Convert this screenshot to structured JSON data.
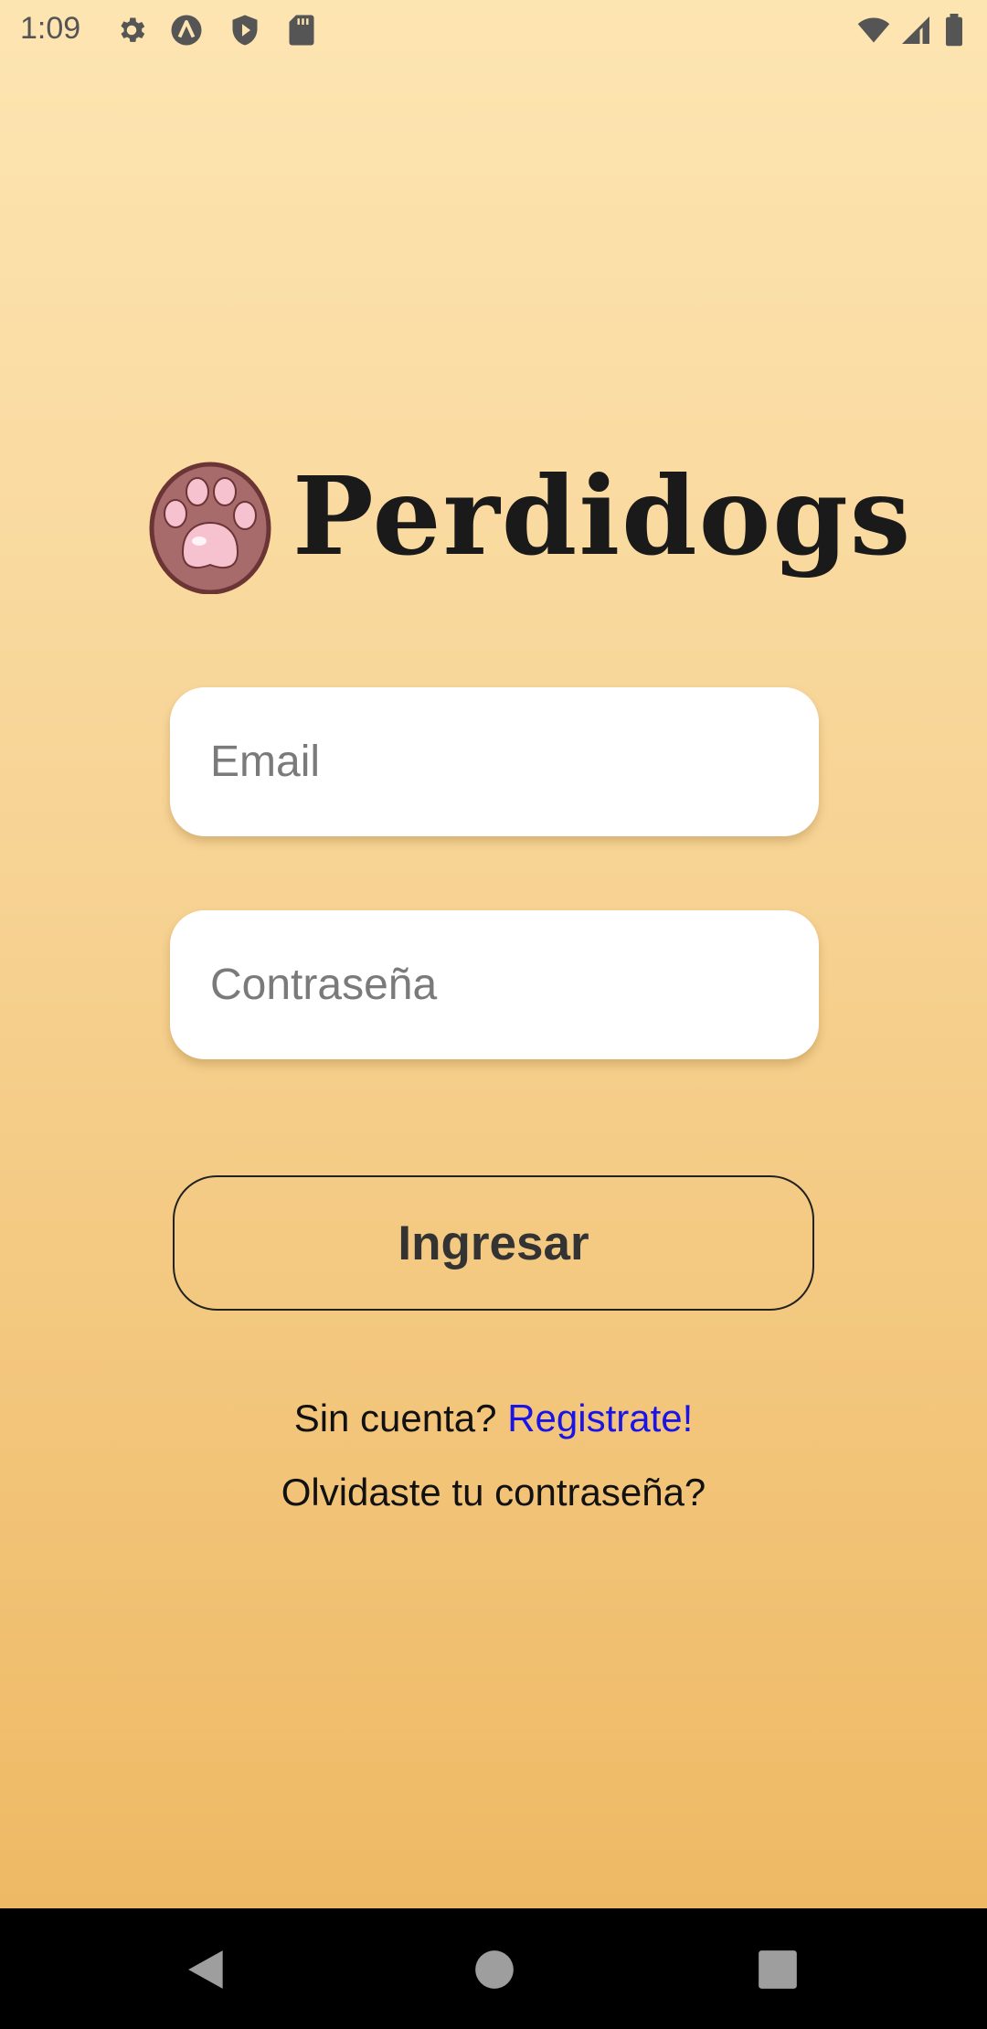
{
  "status_bar": {
    "time": "1:09",
    "left_icons": [
      "settings-icon",
      "app-a-icon",
      "shield-play-icon",
      "sd-card-icon"
    ],
    "right_icons": [
      "wifi-icon",
      "signal-icon",
      "battery-icon"
    ]
  },
  "brand": {
    "logo_icon": "paw-icon",
    "name": "Perdidogs"
  },
  "form": {
    "email": {
      "placeholder": "Email",
      "value": ""
    },
    "password": {
      "placeholder": "Contraseña",
      "value": ""
    },
    "submit_label": "Ingresar"
  },
  "links": {
    "signup_prompt": "Sin cuenta?",
    "signup_link": "Registrate!",
    "forgot_password": "Olvidaste tu contraseña?"
  },
  "nav_bar": {
    "buttons": [
      "back-icon",
      "home-icon",
      "recents-icon"
    ]
  },
  "colors": {
    "background_top": "#fde5b2",
    "background_bottom": "#eeb964",
    "link": "#1a14e6",
    "paw_outer": "#a86b6b",
    "paw_pad": "#f7c2d0"
  }
}
